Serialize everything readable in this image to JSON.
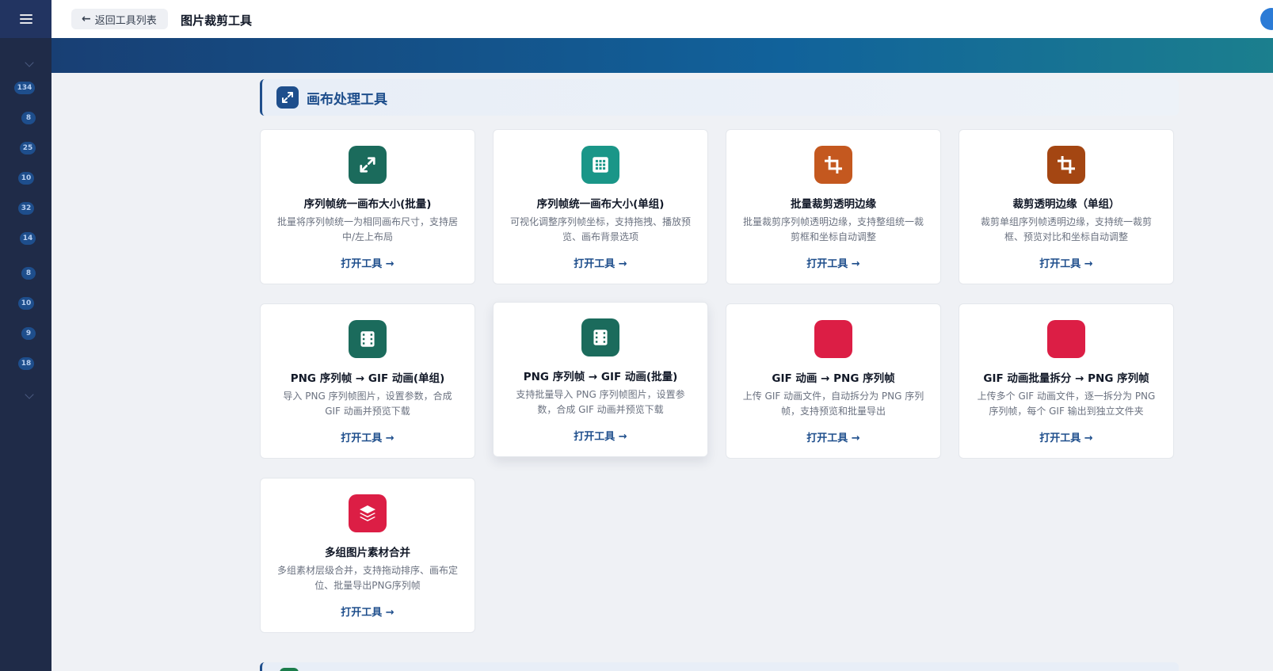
{
  "header": {
    "back_label": "返回工具列表",
    "title": "图片裁剪工具"
  },
  "sidebar": {
    "badges": [
      "134",
      "8",
      "25",
      "10",
      "32",
      "14",
      "8",
      "10",
      "9",
      "18"
    ]
  },
  "section": {
    "title": "画布处理工具"
  },
  "colors": {
    "sidebar": "#1f2b48",
    "accent": "#1e4e8c",
    "teal_dark": "#1b6b5c",
    "teal_light": "#1a9688",
    "orange": "#c4581f",
    "orange_dark": "#a44612",
    "crimson": "#dc1e45"
  },
  "cards": [
    {
      "title": "序列帧统一画布大小(批量)",
      "desc": "批量将序列帧统一为相同画布尺寸，支持居中/左上布局",
      "link": "打开工具 →",
      "icon": "expand-arrows-icon"
    },
    {
      "title": "序列帧统一画布大小(单组)",
      "desc": "可视化调整序列帧坐标，支持拖拽、播放预览、画布背景选项",
      "link": "打开工具 →",
      "icon": "grid-icon"
    },
    {
      "title": "批量裁剪透明边缘",
      "desc": "批量裁剪序列帧透明边缘，支持整组统一裁剪框和坐标自动调整",
      "link": "打开工具 →",
      "icon": "crop-icon"
    },
    {
      "title": "裁剪透明边缘（单组）",
      "desc": "裁剪单组序列帧透明边缘，支持统一裁剪框、预览对比和坐标自动调整",
      "link": "打开工具 →",
      "icon": "crop-icon"
    },
    {
      "title": "PNG 序列帧 → GIF 动画(单组)",
      "desc": "导入 PNG 序列帧图片，设置参数，合成 GIF 动画并预览下载",
      "link": "打开工具 →",
      "icon": "film-icon"
    },
    {
      "title": "PNG 序列帧 → GIF 动画(批量)",
      "desc": "支持批量导入 PNG 序列帧图片，设置参数，合成 GIF 动画并预览下载",
      "link": "打开工具 →",
      "icon": "film-icon"
    },
    {
      "title": "GIF 动画 → PNG 序列帧",
      "desc": "上传 GIF 动画文件，自动拆分为 PNG 序列帧，支持预览和批量导出",
      "link": "打开工具 →",
      "icon": "blank-icon"
    },
    {
      "title": "GIF 动画批量拆分 → PNG 序列帧",
      "desc": "上传多个 GIF 动画文件，逐一拆分为 PNG 序列帧，每个 GIF 输出到独立文件夹",
      "link": "打开工具 →",
      "icon": "blank-icon"
    },
    {
      "title": "多组图片素材合并",
      "desc": "多组素材层级合并，支持拖动排序、画布定位、批量导出PNG序列帧",
      "link": "打开工具 →",
      "icon": "layers-icon"
    }
  ]
}
